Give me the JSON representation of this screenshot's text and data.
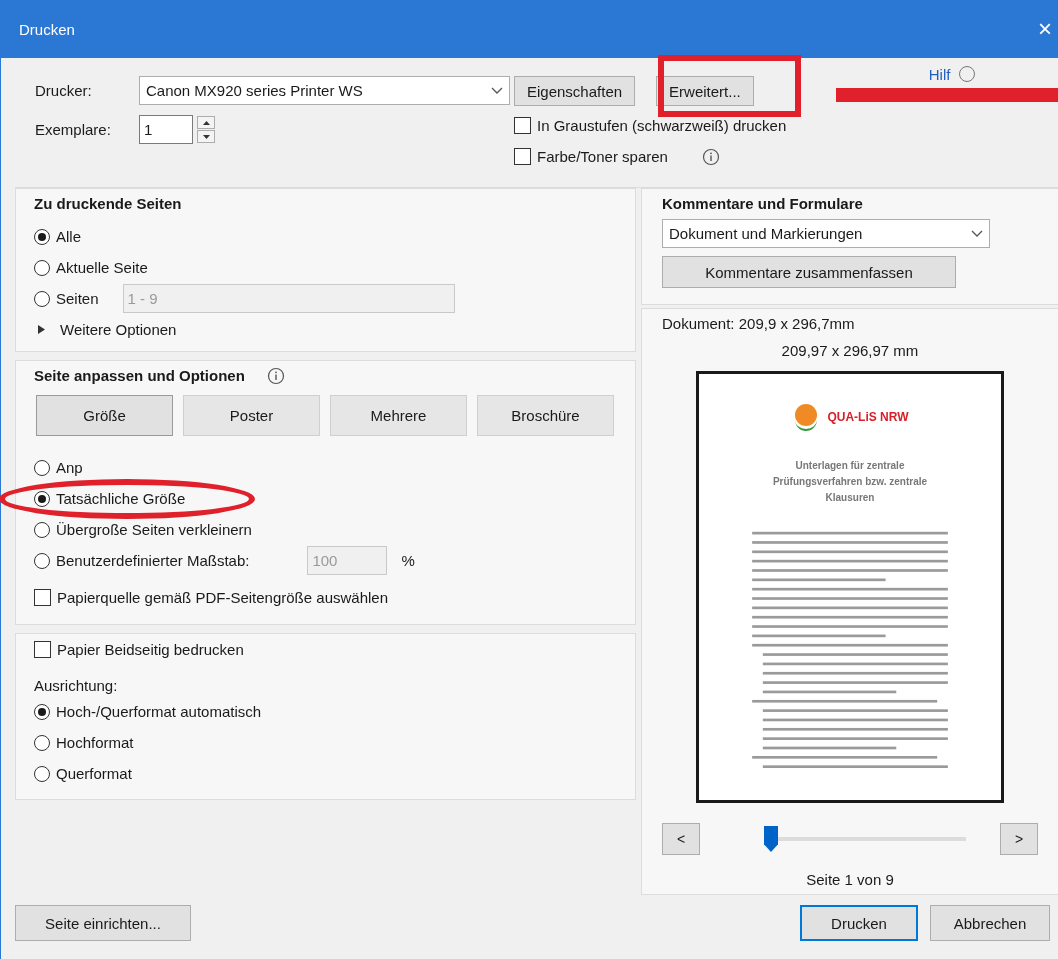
{
  "window": {
    "title": "Drucken",
    "close": "×"
  },
  "printer": {
    "label": "Drucker:",
    "value": "Canon MX920 series Printer WS",
    "buttons": [
      "Eigenschaften",
      "Erweitert..."
    ],
    "help": "Hilf"
  },
  "copies": {
    "label": "Exemplare:",
    "value": "1"
  },
  "options": [
    {
      "label": "In Graustufen (schwarzweiß) drucken",
      "checked": false,
      "info": false
    },
    {
      "label": "Farbe/Toner sparen",
      "checked": false,
      "info": true
    }
  ],
  "pages": {
    "title": "Zu druckende Seiten",
    "choices": [
      {
        "label": "Alle",
        "selected": true
      },
      {
        "label": "Aktuelle Seite",
        "selected": false
      },
      {
        "label": "Seiten",
        "selected": false,
        "placeholder": "1 - 9"
      }
    ],
    "more": "Weitere Optionen",
    "expanded": false
  },
  "sizing": {
    "title": "Seite anpassen und Optionen",
    "tabs": [
      {
        "label": "Größe",
        "selected": true
      },
      {
        "label": "Poster",
        "selected": false
      },
      {
        "label": "Mehrere",
        "selected": false
      },
      {
        "label": "Broschüre",
        "selected": false
      }
    ],
    "choices": [
      {
        "label": "Anp",
        "selected": false
      },
      {
        "label": "Tatsächliche Größe",
        "selected": true
      },
      {
        "label": "Übergroße Seiten verkleinern",
        "selected": false
      },
      {
        "label": "Benutzerdefinierter Maßstab:",
        "selected": false,
        "placeholder": "100",
        "unit": "%"
      }
    ],
    "paper_source": {
      "label": "Papierquelle gemäß PDF-Seitengröße auswählen",
      "checked": false
    }
  },
  "duplex": {
    "label": "Papier Beidseitig bedrucken",
    "checked": false
  },
  "orientation": {
    "label": "Ausrichtung:",
    "choices": [
      {
        "label": "Hoch-/Querformat automatisch",
        "selected": true
      },
      {
        "label": "Hochformat",
        "selected": false
      },
      {
        "label": "Querformat",
        "selected": false
      }
    ]
  },
  "comments": {
    "title": "Kommentare und Formulare",
    "value": "Dokument und Markierungen",
    "button": "Kommentare zusammenfassen"
  },
  "preview": {
    "document": "Dokument: 209,9 x 296,7mm",
    "paper": "209,97 x 296,97 mm",
    "page": {
      "logo": "QUA-LiS NRW",
      "title": "Unterlagen für zentrale Prüfungsverfahren bzw. zentrale Klausuren"
    },
    "prev": "<",
    "next": ">",
    "level": 0,
    "status": "Seite 1 von 9"
  },
  "footer": {
    "setup": "Seite einrichten...",
    "print": "Drucken",
    "cancel": "Abbrechen"
  }
}
